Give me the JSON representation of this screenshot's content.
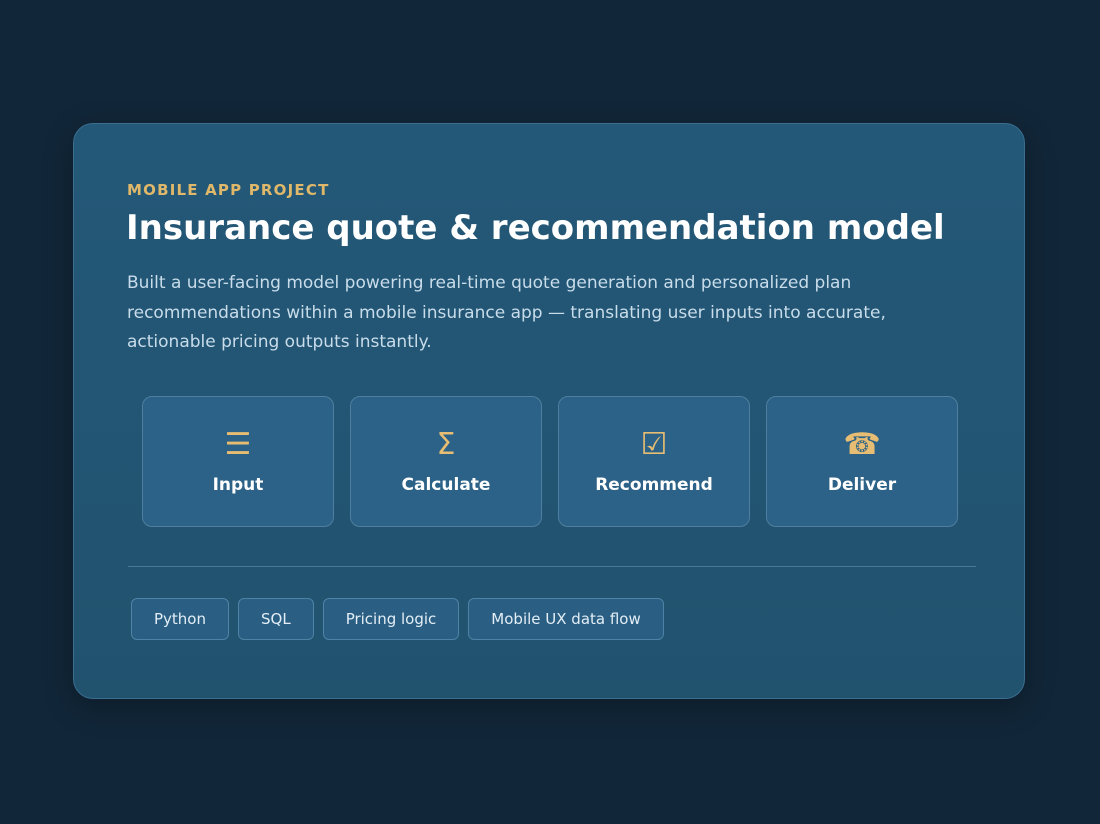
{
  "card": {
    "eyebrow": "MOBILE APP PROJECT",
    "title": "Insurance quote & recommendation model",
    "description": "Built a user-facing model powering real-time quote generation and personalized plan recommendations within a mobile insurance app — translating user inputs into accurate, actionable pricing outputs instantly."
  },
  "steps": [
    {
      "icon": "☰",
      "icon_name": "list-icon",
      "label": "Input"
    },
    {
      "icon": "Σ",
      "icon_name": "sigma-icon",
      "label": "Calculate"
    },
    {
      "icon": "☑",
      "icon_name": "checkbox-icon",
      "label": "Recommend"
    },
    {
      "icon": "☎",
      "icon_name": "telephone-icon",
      "label": "Deliver"
    }
  ],
  "tags": [
    "Python",
    "SQL",
    "Pricing logic",
    "Mobile UX data flow"
  ],
  "colors": {
    "background": "#112638",
    "card": "#245878",
    "accent": "#e0b86a",
    "step_tile": "#2c6287",
    "tag": "#2a5f83"
  }
}
